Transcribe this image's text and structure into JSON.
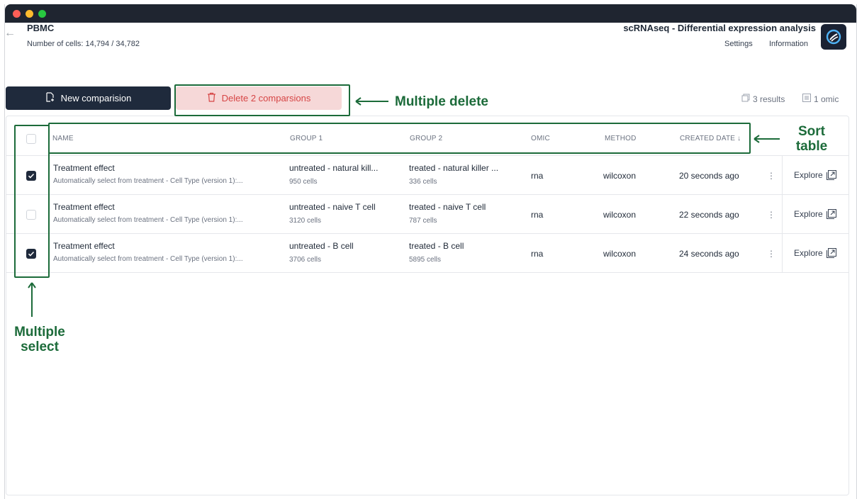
{
  "header": {
    "project_title": "PBMC",
    "cell_count": "Number of cells: 14,794 / 34,782",
    "analysis_title": "scRNAseq - Differential expression analysis",
    "settings_label": "Settings",
    "information_label": "Information"
  },
  "toolbar": {
    "new_label": "New comparision",
    "delete_label": "Delete 2 comparsions",
    "results_label": "3 results",
    "omic_label": "1 omic"
  },
  "annotations": {
    "multiple_delete": "Multiple delete",
    "sort_table_1": "Sort",
    "sort_table_2": "table",
    "multiple_select_1": "Multiple",
    "multiple_select_2": "select"
  },
  "table": {
    "columns": {
      "name": "NAME",
      "group1": "GROUP 1",
      "group2": "GROUP 2",
      "omic": "OMIC",
      "method": "METHOD",
      "created": "CREATED DATE ↓"
    },
    "explore_label": "Explore",
    "rows": [
      {
        "checked": true,
        "name": "Treatment effect",
        "description": "Automatically select from treatment - Cell Type (version 1):...",
        "group1": "untreated - natural kill...",
        "group1_cells": "950 cells",
        "group2": "treated - natural killer ...",
        "group2_cells": "336 cells",
        "omic": "rna",
        "method": "wilcoxon",
        "created": "20 seconds ago"
      },
      {
        "checked": false,
        "name": "Treatment effect",
        "description": "Automatically select from treatment - Cell Type (version 1):...",
        "group1": "untreated - naive T cell",
        "group1_cells": "3120 cells",
        "group2": "treated - naive T cell",
        "group2_cells": "787 cells",
        "omic": "rna",
        "method": "wilcoxon",
        "created": "22 seconds ago"
      },
      {
        "checked": true,
        "name": "Treatment effect",
        "description": "Automatically select from treatment - Cell Type (version 1):...",
        "group1": "untreated - B cell",
        "group1_cells": "3706 cells",
        "group2": "treated - B cell",
        "group2_cells": "5895 cells",
        "omic": "rna",
        "method": "wilcoxon",
        "created": "24 seconds ago"
      }
    ]
  },
  "colors": {
    "annotation": "#1c6b3a",
    "primary_button": "#1f2a3c",
    "danger_bg": "#f6d8d8",
    "danger_text": "#d64545"
  }
}
